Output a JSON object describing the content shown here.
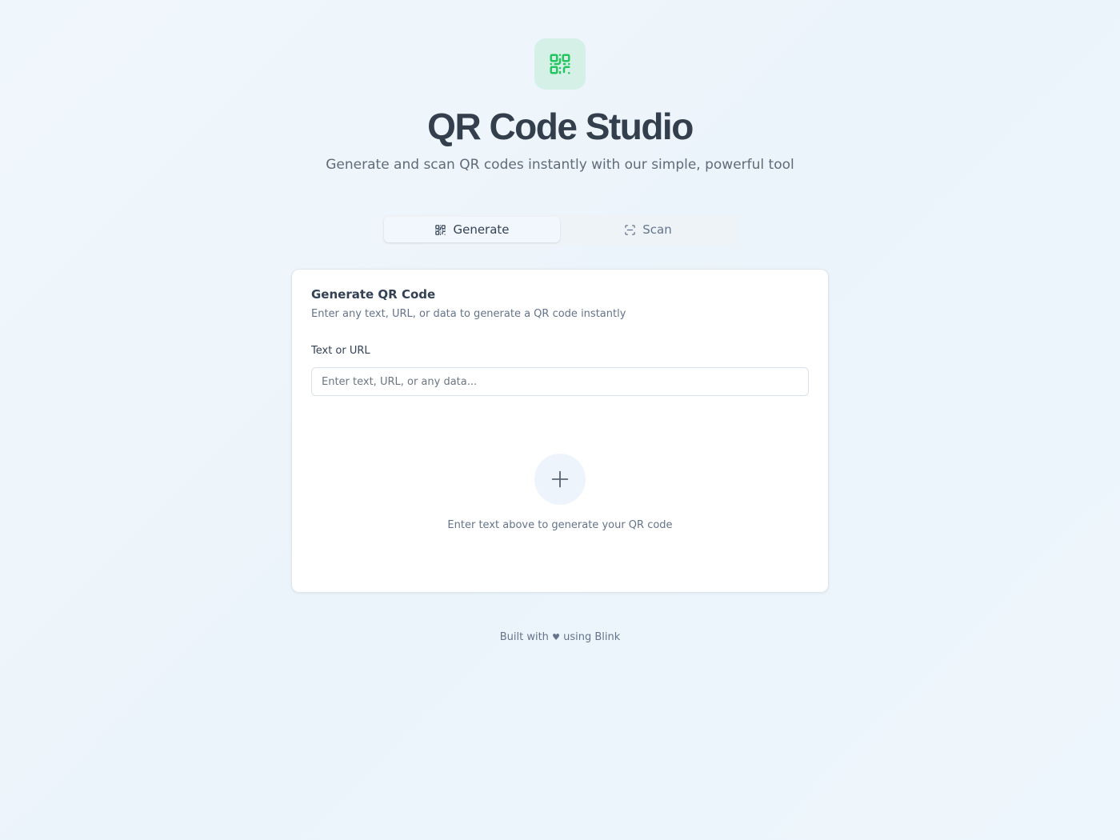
{
  "app": {
    "title": "QR Code Studio",
    "subtitle": "Generate and scan QR codes instantly with our simple, powerful tool",
    "logo_icon": "qr-code-icon",
    "accent_color": "#22c55e"
  },
  "tabs": [
    {
      "label": "Generate",
      "icon": "qr-code-icon",
      "active": true
    },
    {
      "label": "Scan",
      "icon": "scan-icon",
      "active": false
    }
  ],
  "generator": {
    "title": "Generate QR Code",
    "description": "Enter any text, URL, or data to generate a QR code instantly",
    "field_label": "Text or URL",
    "input_value": "",
    "input_placeholder": "Enter text, URL, or any data...",
    "empty_icon": "plus-icon",
    "empty_message": "Enter text above to generate your QR code"
  },
  "footer": {
    "prefix": "Built with",
    "heart_icon": "heart-icon",
    "heart_glyph": "♥",
    "suffix": "using Blink"
  }
}
